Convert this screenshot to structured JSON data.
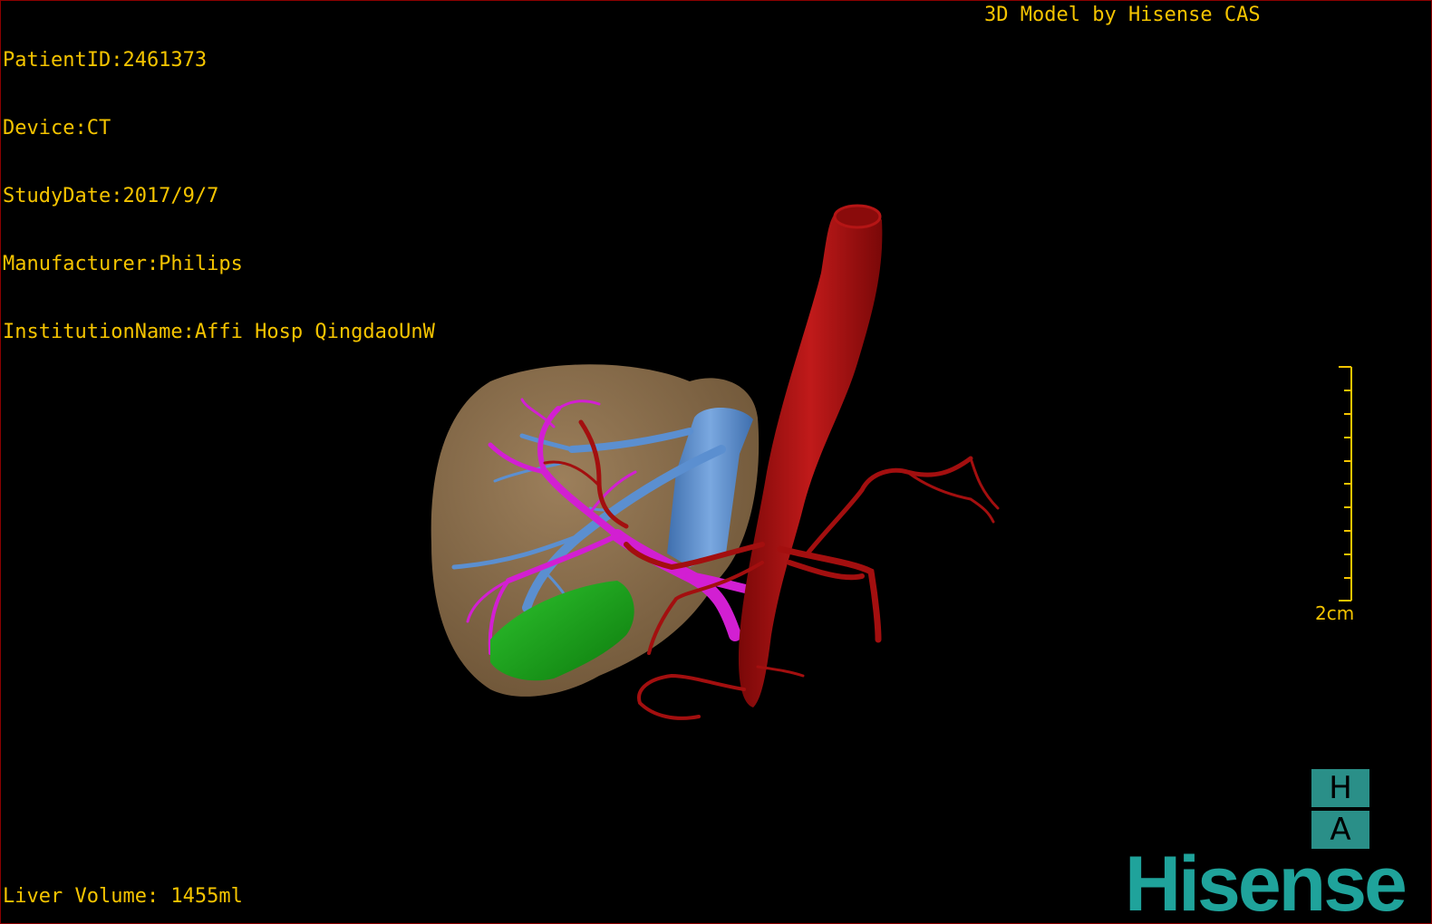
{
  "header": {
    "patient_id": "PatientID:2461373",
    "device": "Device:CT",
    "study_date": "StudyDate:2017/9/7",
    "manufacturer": "Manufacturer:Philips",
    "institution": "InstitutionName:Affi Hosp QingdaoUnW"
  },
  "title": "3D Model by Hisense CAS",
  "footer": {
    "liver_volume": "Liver Volume: 1455ml"
  },
  "scale_bar": {
    "label": "2cm"
  },
  "logo": {
    "top_letter": "H",
    "bottom_letter": "A",
    "brand": "Hisense"
  },
  "colors": {
    "overlay_text": "#f5c400",
    "liver": "#8c7150",
    "artery": "#a30f0f",
    "hepatic_vein": "#5b8fd0",
    "portal_vein": "#d21fd2",
    "lesion": "#18a018",
    "brand": "#1fa39b"
  }
}
